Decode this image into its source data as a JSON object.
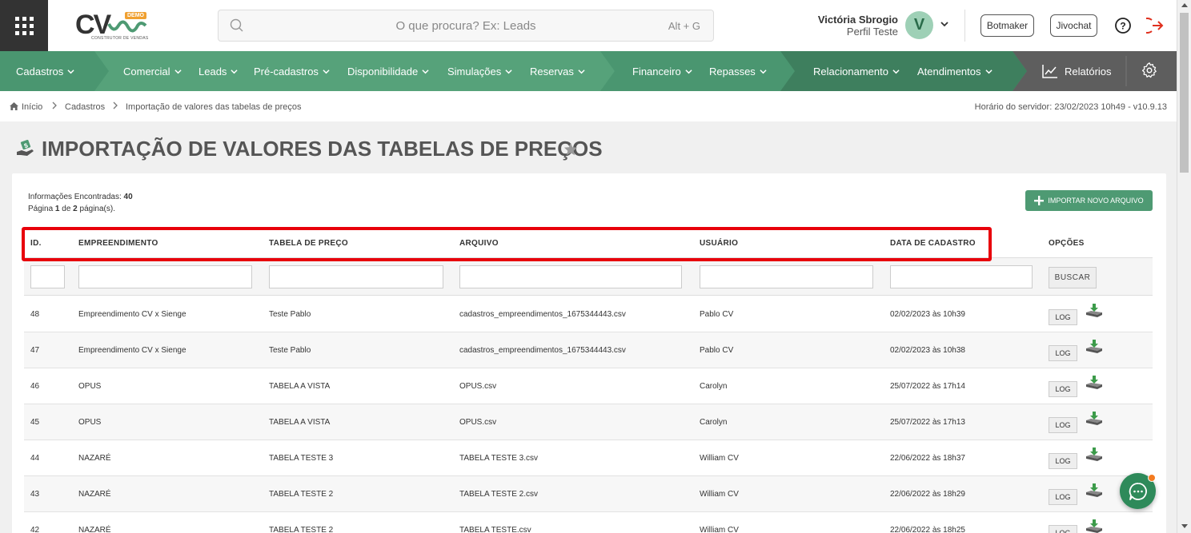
{
  "header": {
    "logo_text": "CV",
    "logo_badge": "DEMO",
    "logo_subtitle": "CONSTRUTOR DE VENDAS",
    "search_placeholder": "O que procura? Ex: Leads",
    "search_shortcut": "Alt + G",
    "user_name": "Victória Sbrogio",
    "user_profile": "Perfil Teste",
    "avatar_letter": "V",
    "botmaker_label": "Botmaker",
    "jivochat_label": "Jivochat"
  },
  "nav": {
    "items": [
      {
        "label": "Cadastros"
      },
      {
        "label": "Comercial"
      },
      {
        "label": "Leads"
      },
      {
        "label": "Pré-cadastros"
      },
      {
        "label": "Disponibilidade"
      },
      {
        "label": "Simulações"
      },
      {
        "label": "Reservas"
      },
      {
        "label": "Financeiro"
      },
      {
        "label": "Repasses"
      },
      {
        "label": "Relacionamento"
      },
      {
        "label": "Atendimentos"
      }
    ],
    "relatorios_label": "Relatórios"
  },
  "breadcrumb": {
    "items": [
      "Início",
      "Cadastros",
      "Importação de valores das tabelas de preços"
    ],
    "server_time": "Horário do servidor: 23/02/2023 10h49 - v10.9.13"
  },
  "page": {
    "title": "IMPORTAÇÃO DE VALORES DAS TABELAS DE PREÇOS"
  },
  "info": {
    "found_label": "Informações Encontradas:",
    "found_count": "40",
    "page_prefix": "Página",
    "page_current": "1",
    "page_mid": "de",
    "page_total": "2",
    "page_suffix": "página(s)."
  },
  "import_button_label": "IMPORTAR NOVO ARQUIVO",
  "table": {
    "columns": [
      "ID.",
      "EMPREENDIMENTO",
      "TABELA DE PREÇO",
      "ARQUIVO",
      "USUÁRIO",
      "DATA DE CADASTRO",
      "OPÇÕES"
    ],
    "search_label": "BUSCAR",
    "log_label": "LOG",
    "rows": [
      {
        "id": "48",
        "empreendimento": "Empreendimento CV x Sienge",
        "tabela": "Teste Pablo",
        "arquivo": "cadastros_empreendimentos_1675344443.csv",
        "usuario": "Pablo CV",
        "data": "02/02/2023 às 10h39"
      },
      {
        "id": "47",
        "empreendimento": "Empreendimento CV x Sienge",
        "tabela": "Teste Pablo",
        "arquivo": "cadastros_empreendimentos_1675344443.csv",
        "usuario": "Pablo CV",
        "data": "02/02/2023 às 10h38"
      },
      {
        "id": "46",
        "empreendimento": "OPUS",
        "tabela": "TABELA A VISTA",
        "arquivo": "OPUS.csv",
        "usuario": "Carolyn",
        "data": "25/07/2022 às 17h14"
      },
      {
        "id": "45",
        "empreendimento": "OPUS",
        "tabela": "TABELA A VISTA",
        "arquivo": "OPUS.csv",
        "usuario": "Carolyn",
        "data": "25/07/2022 às 17h13"
      },
      {
        "id": "44",
        "empreendimento": "NAZARÉ",
        "tabela": "TABELA TESTE 3",
        "arquivo": "TABELA TESTE 3.csv",
        "usuario": "William CV",
        "data": "22/06/2022 às 18h37"
      },
      {
        "id": "43",
        "empreendimento": "NAZARÉ",
        "tabela": "TABELA TESTE 2",
        "arquivo": "TABELA TESTE 2.csv",
        "usuario": "William CV",
        "data": "22/06/2022 às 18h29"
      },
      {
        "id": "42",
        "empreendimento": "NAZARÉ",
        "tabela": "TABELA TESTE 2",
        "arquivo": "TABELA TESTE.csv",
        "usuario": "William CV",
        "data": "22/06/2022 às 18h25"
      }
    ]
  },
  "colors": {
    "nav_green": "#4e9a73",
    "nav_dark_green": "#3d7a5a",
    "nav_gray": "#5e5e5e",
    "highlight_red": "#e8000b",
    "chat_badge": "#f47b20"
  }
}
